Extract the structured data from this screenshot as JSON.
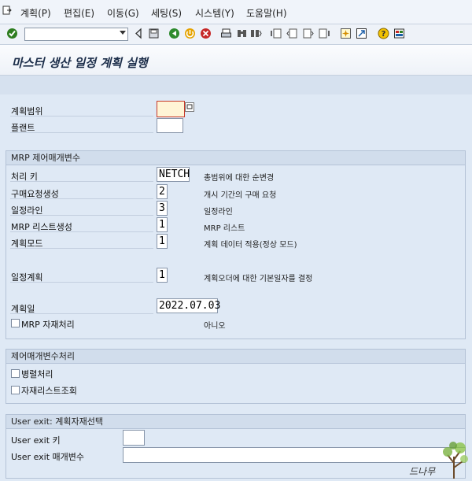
{
  "menu": {
    "items": [
      "계획(P)",
      "편집(E)",
      "이동(G)",
      "세팅(S)",
      "시스템(Y)",
      "도움말(H)"
    ]
  },
  "toolbar": {
    "command_value": "",
    "icons": [
      "enter-icon",
      "back-icon",
      "save-icon",
      "back-green-icon",
      "exit-icon",
      "cancel-icon",
      "print-icon",
      "find-icon",
      "find-next-icon",
      "first-page-icon",
      "prev-page-icon",
      "next-page-icon",
      "last-page-icon",
      "create-session-icon",
      "shortcut-icon",
      "help-icon",
      "layout-icon"
    ]
  },
  "title": "마스터 생산 일정 계획 실행",
  "selection": {
    "scope_label": "계획범위",
    "scope_value": "",
    "plant_label": "플랜트",
    "plant_value": ""
  },
  "mrp_group": {
    "title": "MRP 제어매개변수",
    "rows": [
      {
        "label": "처리 키",
        "value": "NETCH",
        "desc": "총범위에 대한 순변경"
      },
      {
        "label": "구매요청생성",
        "value": "2",
        "desc": "개시 기간의 구매 요청"
      },
      {
        "label": "일정라인",
        "value": "3",
        "desc": "일정라인"
      },
      {
        "label": "MRP 리스트생성",
        "value": "1",
        "desc": "MRP 리스트"
      },
      {
        "label": "계획모드",
        "value": "1",
        "desc": "계획 데이터 적용(정상 모드)"
      },
      {
        "label": "일정계획",
        "value": "1",
        "desc": "계획오더에 대한 기본일자를 결정"
      }
    ],
    "plan_date_label": "계획일",
    "plan_date_value": "2022.07.03",
    "mrp_material_label": "MRP 자재처리",
    "mrp_material_desc": "아니오"
  },
  "control_group": {
    "title": "제어매개변수처리",
    "parallel_label": "병렬처리",
    "material_list_label": "자재리스트조회"
  },
  "exit_group": {
    "title": "User exit: 계획자재선택",
    "key_label": "User exit 키",
    "param_label": "User exit 매개변수",
    "key_value": "",
    "param_value": ""
  },
  "watermark_text": "드나무"
}
